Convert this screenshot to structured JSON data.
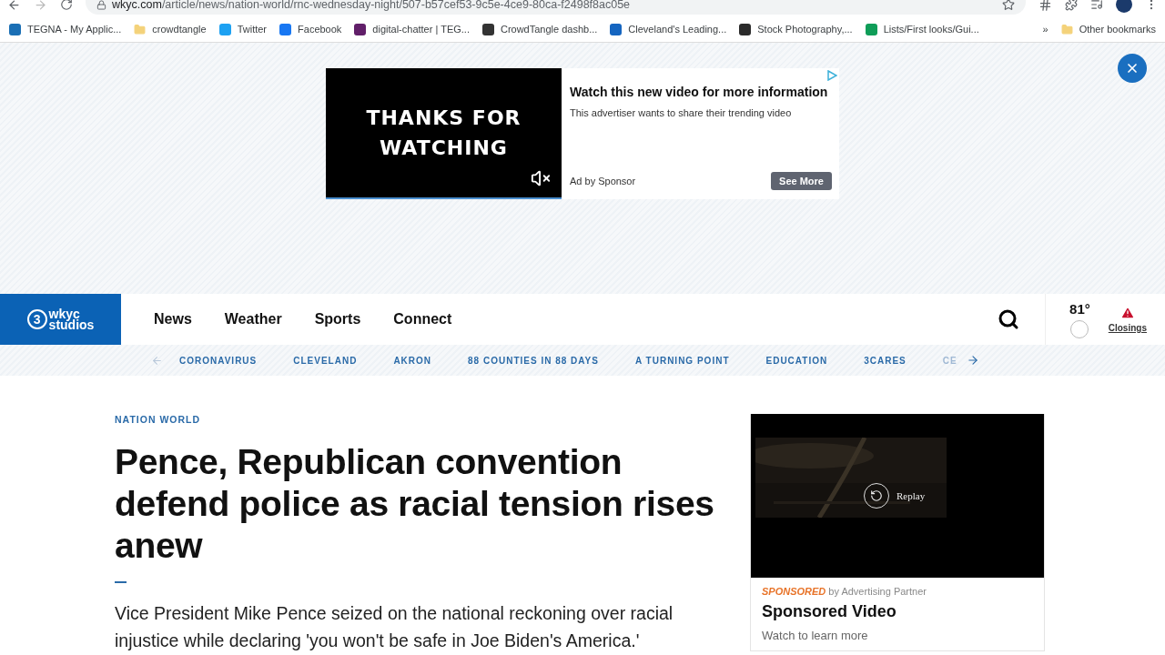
{
  "browser": {
    "url_host": "wkyc.com",
    "url_path": "/article/news/nation-world/rnc-wednesday-night/507-b57cef53-9c5e-4ce9-80ca-f2498f8ac05e"
  },
  "bookmarks": [
    {
      "label": "TEGNA - My Applic...",
      "kind": "site",
      "color": "#1a6fb5"
    },
    {
      "label": "crowdtangle",
      "kind": "folder",
      "color": "#f4d27a"
    },
    {
      "label": "Twitter",
      "kind": "site",
      "color": "#1da1f2"
    },
    {
      "label": "Facebook",
      "kind": "site",
      "color": "#1877f2"
    },
    {
      "label": "digital-chatter | TEG...",
      "kind": "site",
      "color": "#611f69"
    },
    {
      "label": "CrowdTangle dashb...",
      "kind": "site",
      "color": "#333333"
    },
    {
      "label": "Cleveland's Leading...",
      "kind": "site",
      "color": "#1565c0"
    },
    {
      "label": "Stock Photography,...",
      "kind": "site",
      "color": "#2b2b2b"
    },
    {
      "label": "Lists/First looks/Gui...",
      "kind": "site",
      "color": "#0f9d58"
    }
  ],
  "bookmarks_more": "»",
  "other_bookmarks": "Other bookmarks",
  "top_ad": {
    "video_text": "THANKS FOR WATCHING",
    "muted": true,
    "headline": "Watch this new video for more information",
    "body": "This advertiser wants to share their trending video",
    "by": "Ad by Sponsor",
    "button": "See More"
  },
  "nav": {
    "logo_number": "3",
    "logo_line1": "wkyc",
    "logo_line2": "studios",
    "links": [
      "News",
      "Weather",
      "Sports",
      "Connect"
    ],
    "temperature": "81°",
    "closings": "Closings"
  },
  "subnav": [
    "CORONAVIRUS",
    "CLEVELAND",
    "AKRON",
    "88 COUNTIES IN 88 DAYS",
    "A TURNING POINT",
    "EDUCATION",
    "3CARES",
    "CE"
  ],
  "article": {
    "section": "NATION WORLD",
    "headline": "Pence, Republican convention defend police as racial tension rises anew",
    "summary": "Vice President Mike Pence seized on the national reckoning over racial injustice while declaring 'you won't be safe in Joe Biden's America.'"
  },
  "side_ad": {
    "replay": "Replay",
    "sponsor": "*SPONSORED* by Advertising Partner",
    "title": "Sponsored Video",
    "subtitle": "Watch to learn more"
  }
}
